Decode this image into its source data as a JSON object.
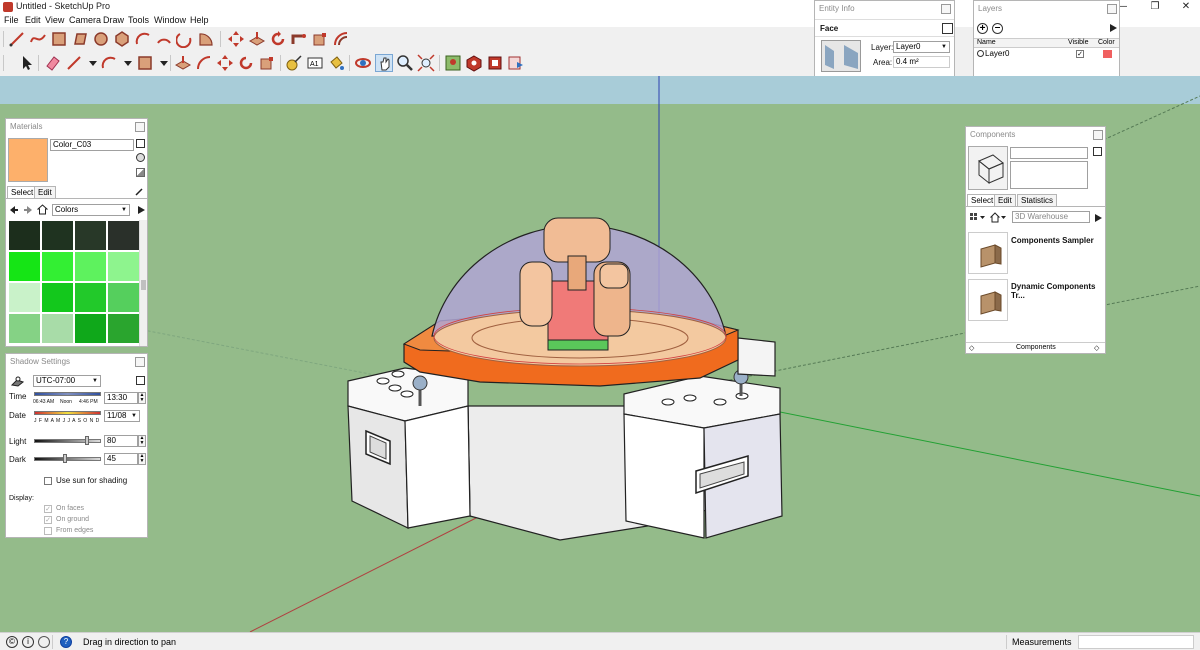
{
  "app": {
    "window_title": "Untitled - SketchUp Pro"
  },
  "window_controls": {
    "minimize": "—",
    "maximize": "❐",
    "close": "✕"
  },
  "menu": [
    "File",
    "Edit",
    "View",
    "Camera",
    "Draw",
    "Tools",
    "Window",
    "Help"
  ],
  "entity_info": {
    "title": "Entity Info",
    "type": "Face",
    "layer_label": "Layer:",
    "layer_value": "Layer0",
    "area_label": "Area:",
    "area_value": "0.4 m²"
  },
  "layers": {
    "title": "Layers",
    "col_name": "Name",
    "col_visible": "Visible",
    "col_color": "Color",
    "rows": [
      {
        "name": "Layer0",
        "visible": "✓",
        "color": "#f06060"
      }
    ]
  },
  "materials": {
    "title": "Materials",
    "current_name": "Color_C03",
    "current_color": "#fdb06b",
    "tabs": {
      "select": "Select",
      "edit": "Edit"
    },
    "library": "Colors",
    "swatches": [
      "#1c2e1c",
      "#1f3320",
      "#283828",
      "#2a302a",
      "#15e515",
      "#33ef33",
      "#5ef25e",
      "#8ef48e",
      "#c9f2c9",
      "#13c81c",
      "#22c92a",
      "#55cf5d",
      "#85d285",
      "#a8dca8",
      "#0fa81a",
      "#2aa52e"
    ]
  },
  "shadow_settings": {
    "title": "Shadow Settings",
    "timezone": "UTC-07:00",
    "time_label": "Time",
    "time_start": "06:43 AM",
    "time_noon": "Noon",
    "time_end": "4:46 PM",
    "time_value": "13:30",
    "date_label": "Date",
    "months": "J F M A M J J A S O N D",
    "date_value": "11/08",
    "light_label": "Light",
    "light_value": "80",
    "dark_label": "Dark",
    "dark_value": "45",
    "use_sun_label": "Use sun for shading",
    "display_label": "Display:",
    "on_faces": "On faces",
    "on_ground": "On ground",
    "from_edges": "From edges",
    "checkmark": "✓"
  },
  "components": {
    "title": "Components",
    "tabs": {
      "select": "Select",
      "edit": "Edit",
      "statistics": "Statistics"
    },
    "search_placeholder": "3D Warehouse",
    "items": [
      {
        "name": "Components Sampler"
      },
      {
        "name": "Dynamic Components Tr..."
      }
    ],
    "footer": "Components"
  },
  "status": {
    "message": "Drag in direction to pan",
    "measurements_label": "Measurements",
    "help_icon": "?",
    "info_icon": "i",
    "geo_icon": "©"
  },
  "colors": {
    "accent_red": "#cc2020",
    "sky": "#a8ccd8",
    "ground": "#94bb8a"
  }
}
